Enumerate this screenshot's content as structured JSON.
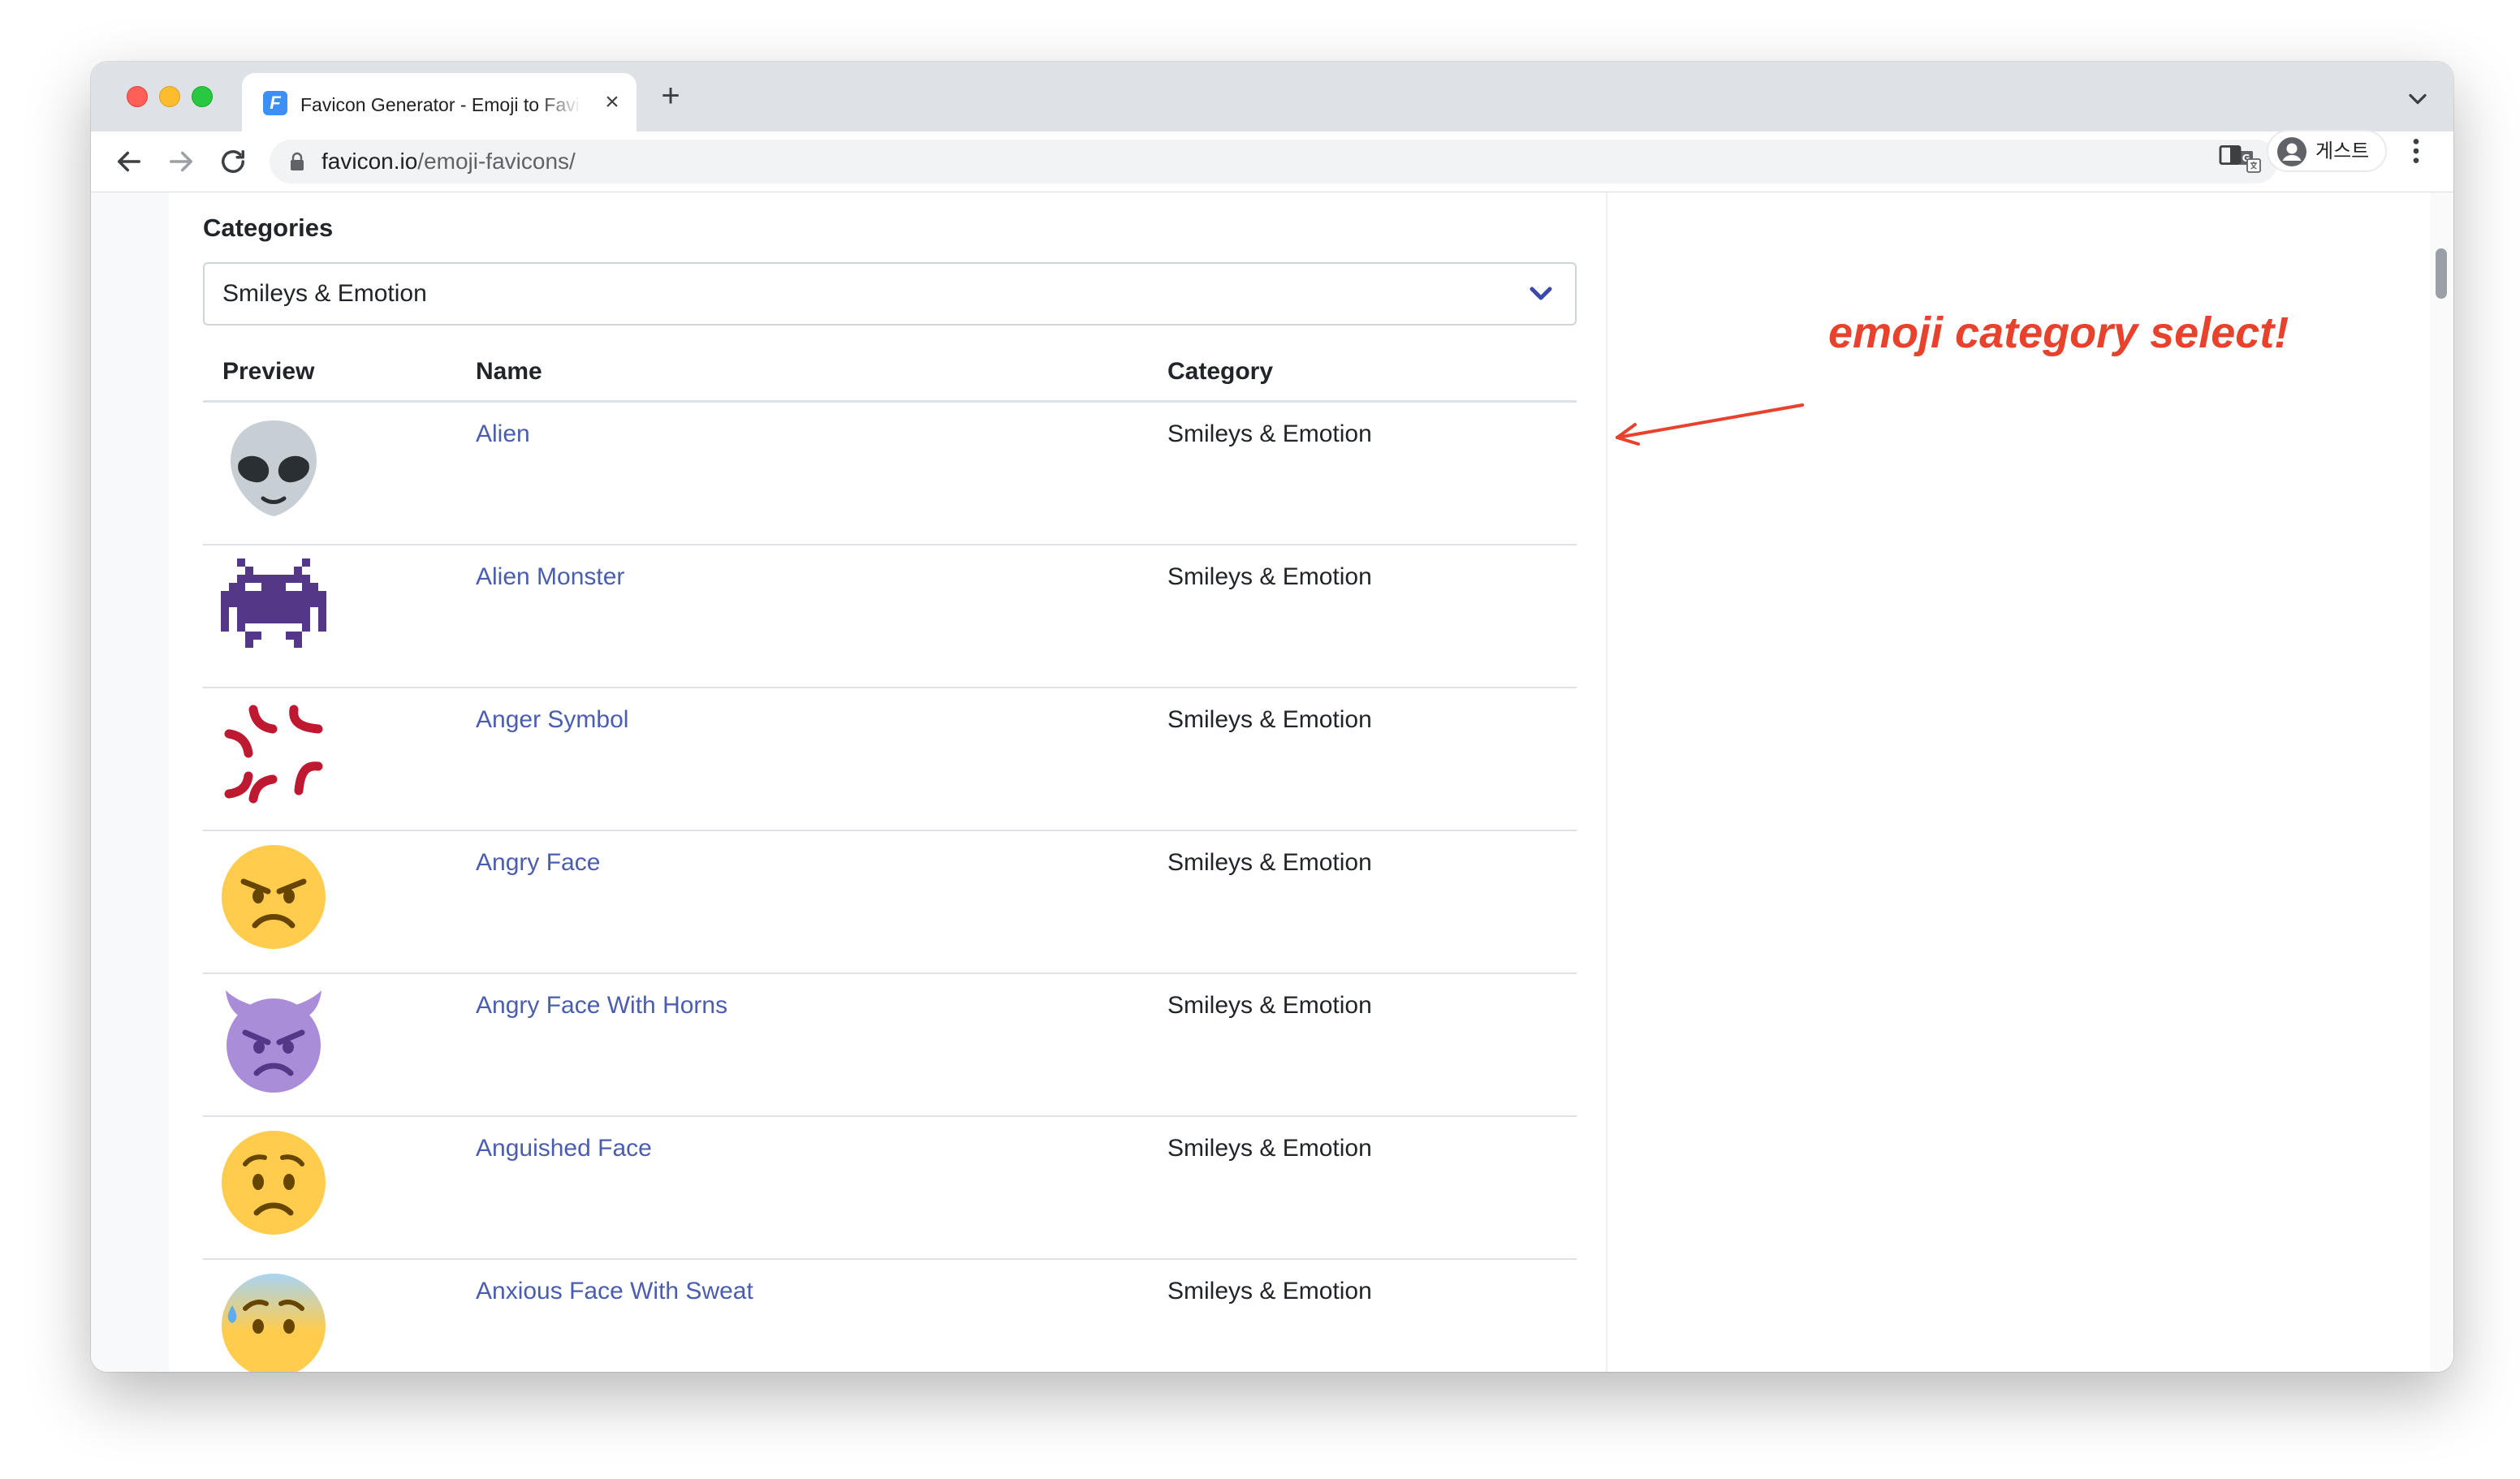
{
  "browser": {
    "tab_title": "Favicon Generator - Emoji to Favicon",
    "tab_favicon_letter": "F",
    "url_host": "favicon.io",
    "url_path": "/emoji-favicons/",
    "profile_label": "게스트",
    "colors": {
      "tabstrip": "#dee1e6",
      "favicon": "#3d8ff5"
    }
  },
  "page": {
    "categories_label": "Categories",
    "selected_category": "Smileys & Emotion",
    "link_color": "#4a5db0",
    "table": {
      "headers": [
        "Preview",
        "Name",
        "Category"
      ],
      "rows": [
        {
          "preview_icon": "alien-emoji-icon",
          "name": "Alien",
          "category": "Smileys & Emotion"
        },
        {
          "preview_icon": "alien-monster-emoji-icon",
          "name": "Alien Monster",
          "category": "Smileys & Emotion"
        },
        {
          "preview_icon": "anger-symbol-emoji-icon",
          "name": "Anger Symbol",
          "category": "Smileys & Emotion"
        },
        {
          "preview_icon": "angry-face-emoji-icon",
          "name": "Angry Face",
          "category": "Smileys & Emotion"
        },
        {
          "preview_icon": "angry-face-with-horns-emoji-icon",
          "name": "Angry Face With Horns",
          "category": "Smileys & Emotion"
        },
        {
          "preview_icon": "anguished-face-emoji-icon",
          "name": "Anguished Face",
          "category": "Smileys & Emotion"
        },
        {
          "preview_icon": "anxious-face-with-sweat-emoji-icon",
          "name": "Anxious Face With Sweat",
          "category": "Smileys & Emotion"
        }
      ]
    }
  },
  "annotation": {
    "text": "emoji category select!",
    "color": "#e8412c"
  }
}
